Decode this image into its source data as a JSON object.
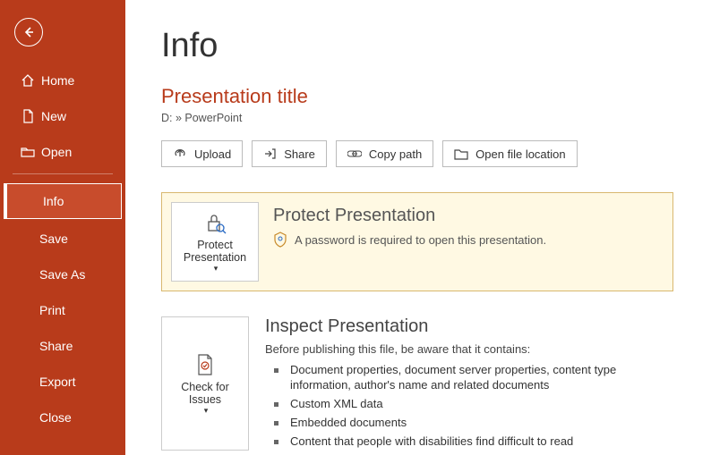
{
  "sidebar": {
    "home": "Home",
    "new": "New",
    "open": "Open",
    "info": "Info",
    "save": "Save",
    "saveas": "Save As",
    "print": "Print",
    "share": "Share",
    "export": "Export",
    "close": "Close"
  },
  "page": {
    "title": "Info",
    "doc_title": "Presentation title",
    "doc_path": "D: » PowerPoint"
  },
  "actions": {
    "upload": "Upload",
    "share": "Share",
    "copy_path": "Copy path",
    "open_location": "Open file location"
  },
  "protect": {
    "tile_label": "Protect Presentation",
    "title": "Protect Presentation",
    "note": "A password is required to open this presentation."
  },
  "inspect": {
    "tile_label": "Check for Issues",
    "title": "Inspect Presentation",
    "lead": "Before publishing this file, be aware that it contains:",
    "items": [
      "Document properties, document server properties, content type information, author's name and related documents",
      "Custom XML data",
      "Embedded documents",
      "Content that people with disabilities find difficult to read"
    ]
  }
}
